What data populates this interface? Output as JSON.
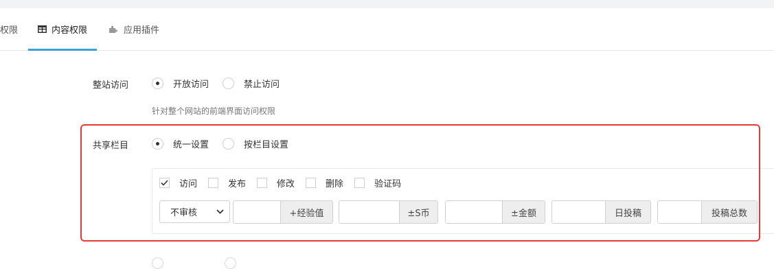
{
  "tabs": [
    {
      "label": "权限"
    },
    {
      "label": "内容权限",
      "active": true,
      "icon": "table-icon"
    },
    {
      "label": "应用插件",
      "icon": "puzzle-icon"
    }
  ],
  "site_access": {
    "label": "整站访问",
    "options": [
      "开放访问",
      "禁止访问"
    ],
    "selected": "开放访问",
    "hint": "针对整个网站的前端界面访问权限"
  },
  "shared_column": {
    "label": "共享栏目",
    "options": [
      "统一设置",
      "按栏目设置"
    ],
    "selected": "统一设置"
  },
  "permissions": [
    {
      "label": "访问",
      "checked": true
    },
    {
      "label": "发布",
      "checked": false
    },
    {
      "label": "修改",
      "checked": false
    },
    {
      "label": "删除",
      "checked": false
    },
    {
      "label": "验证码",
      "checked": false
    }
  ],
  "review_select": {
    "value": "不审核"
  },
  "inputs": [
    {
      "value": "",
      "addon": "+经验值"
    },
    {
      "value": "",
      "addon": "±S币"
    },
    {
      "value": "",
      "addon": "±金额"
    },
    {
      "value": "",
      "addon": "日投稿"
    },
    {
      "value": "",
      "addon": "投稿总数"
    }
  ],
  "colors": {
    "accent": "#3aa0d8",
    "highlight": "#e53935",
    "addon_bg": "#eeeeee"
  }
}
